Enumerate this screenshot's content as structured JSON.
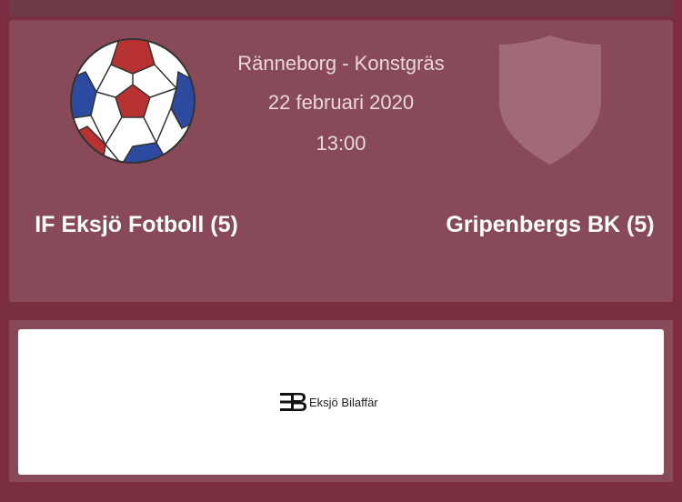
{
  "match": {
    "venue": "Ränneborg - Konstgräs",
    "date": "22 februari 2020",
    "time": "13:00",
    "home_team": "IF Eksjö Fotboll (5)",
    "away_team": "Gripenbergs BK (5)"
  },
  "sponsor": {
    "name": "Eksjö Bilaffär"
  },
  "icons": {
    "home_logo": "football-icon",
    "away_logo": "shield-icon"
  },
  "colors": {
    "background": "#7a2e40",
    "card": "#884a58",
    "ball_red": "#b83232",
    "ball_blue": "#2b4aa0",
    "shield": "#a16a77"
  }
}
